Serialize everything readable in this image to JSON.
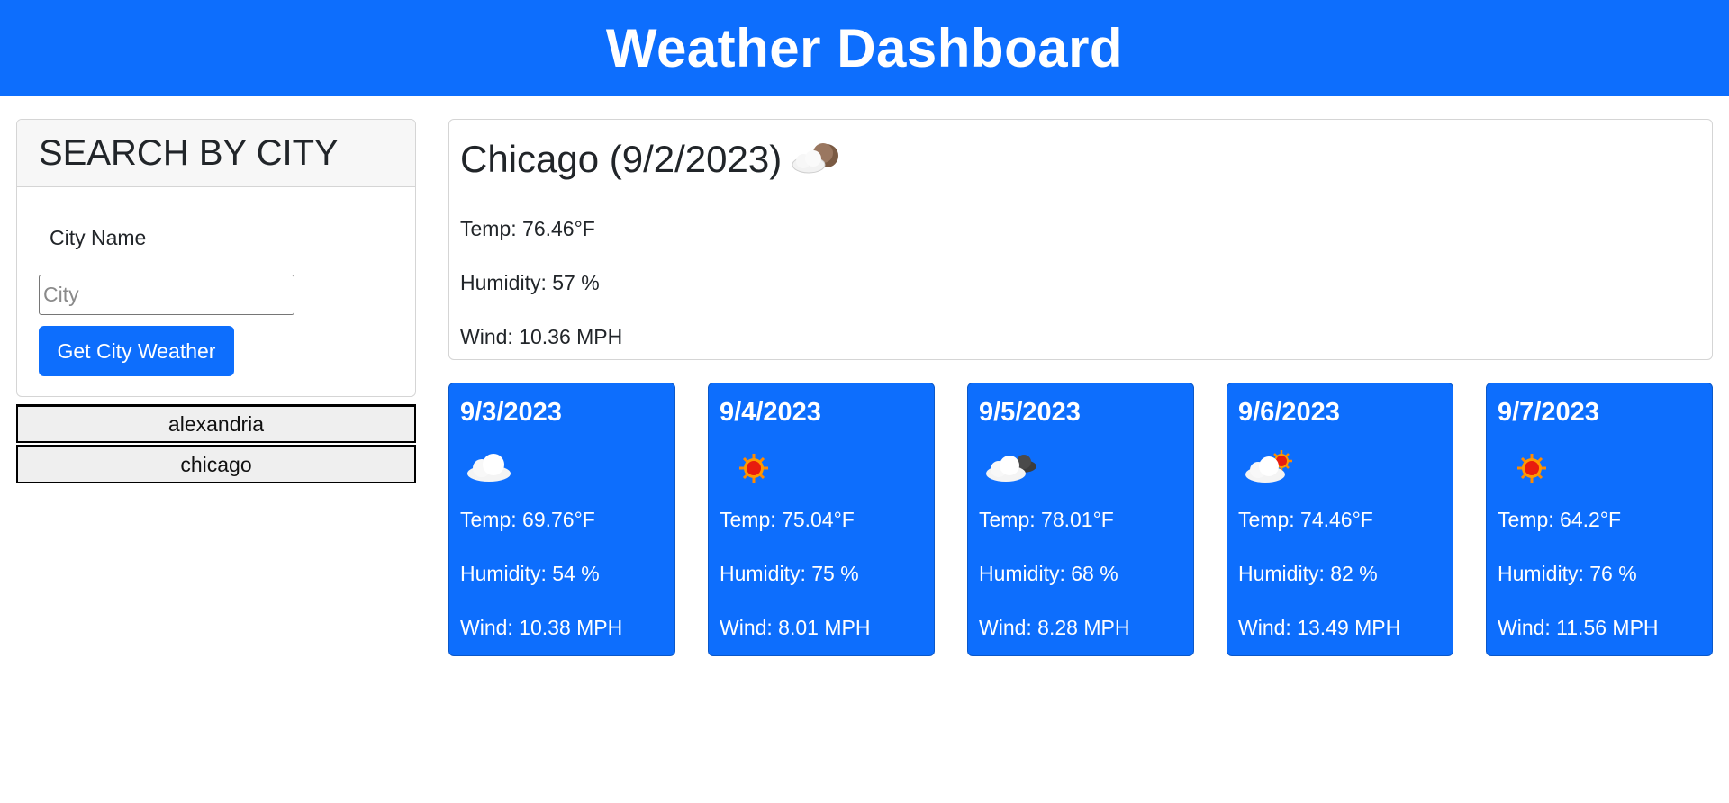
{
  "header": {
    "title": "Weather Dashboard"
  },
  "search": {
    "heading": "SEARCH BY CITY",
    "label": "City Name",
    "input_value": "",
    "input_placeholder": "City",
    "button_label": "Get City Weather"
  },
  "history": [
    "alexandria",
    "chicago"
  ],
  "current": {
    "title": "Chicago (9/2/2023)",
    "icon": "cloud-moon-icon",
    "temp": "Temp: 76.46°F",
    "humidity": "Humidity: 57 %",
    "wind": "Wind: 10.36 MPH"
  },
  "forecast": [
    {
      "date": "9/3/2023",
      "icon": "cloud-icon",
      "temp": "Temp: 69.76°F",
      "humidity": "Humidity: 54 %",
      "wind": "Wind: 10.38 MPH"
    },
    {
      "date": "9/4/2023",
      "icon": "sun-icon",
      "temp": "Temp: 75.04°F",
      "humidity": "Humidity: 75 %",
      "wind": "Wind: 8.01 MPH"
    },
    {
      "date": "9/5/2023",
      "icon": "dark-clouds-icon",
      "temp": "Temp: 78.01°F",
      "humidity": "Humidity: 68 %",
      "wind": "Wind: 8.28 MPH"
    },
    {
      "date": "9/6/2023",
      "icon": "sun-cloud-icon",
      "temp": "Temp: 74.46°F",
      "humidity": "Humidity: 82 %",
      "wind": "Wind: 13.49 MPH"
    },
    {
      "date": "9/7/2023",
      "icon": "sun-icon",
      "temp": "Temp: 64.2°F",
      "humidity": "Humidity: 76 %",
      "wind": "Wind: 11.56 MPH"
    }
  ],
  "colors": {
    "accent": "#0d6efd",
    "header_text": "#ffffff"
  }
}
